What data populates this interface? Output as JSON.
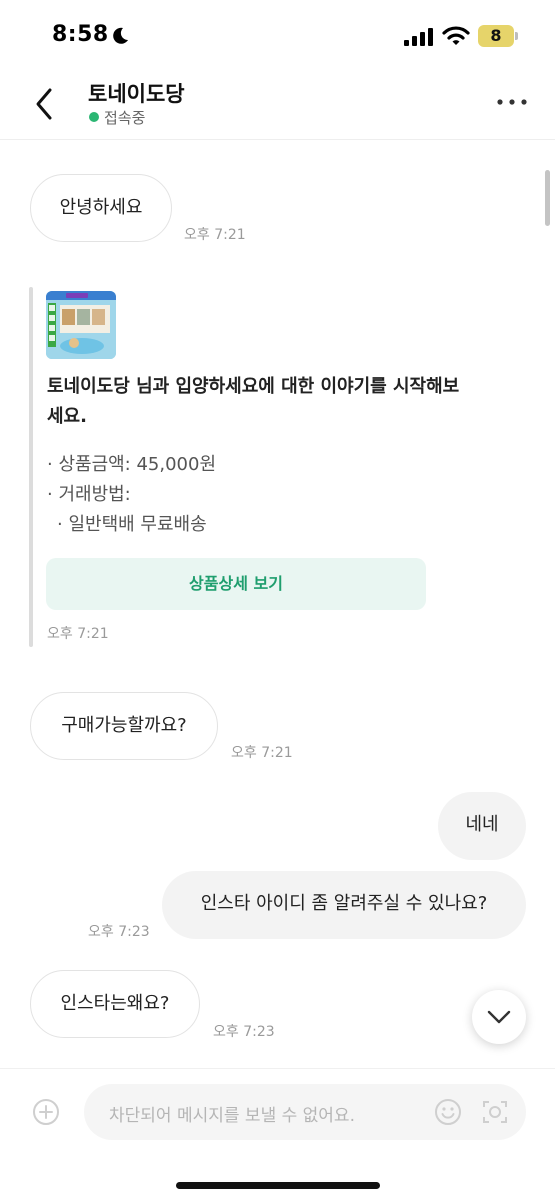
{
  "status_bar": {
    "time": "8:58",
    "battery": "8"
  },
  "header": {
    "title": "토네이도당",
    "status": "접속중"
  },
  "messages": {
    "m1": {
      "text": "안녕하세요",
      "time": "오후 7:21"
    },
    "card": {
      "title": "토네이도당 님과 입양하세요에 대한 이야기를 시작해보세요.",
      "price": "· 상품금액: 45,000원",
      "trade_method": "· 거래방법:",
      "delivery": "· 일반택배 무료배송",
      "button": "상품상세 보기",
      "time": "오후 7:21"
    },
    "m2": {
      "text": "구매가능할까요?",
      "time": "오후 7:21"
    },
    "m3": {
      "text": "네네"
    },
    "m4": {
      "text": "인스타 아이디 좀 알려주실 수 있나요?",
      "time": "오후 7:23"
    },
    "m5": {
      "text": "인스타는왜요?",
      "time": "오후 7:23"
    }
  },
  "input": {
    "placeholder": "차단되어 메시지를 보낼 수 없어요."
  },
  "colors": {
    "online": "#2bb673",
    "accent": "#1f9e6e",
    "button_bg": "#e9f6f2"
  },
  "icons": [
    "moon-icon",
    "signal-icon",
    "wifi-icon",
    "back-icon",
    "more-icon",
    "chevron-down-icon",
    "plus-icon",
    "emoji-icon",
    "camera-icon"
  ]
}
